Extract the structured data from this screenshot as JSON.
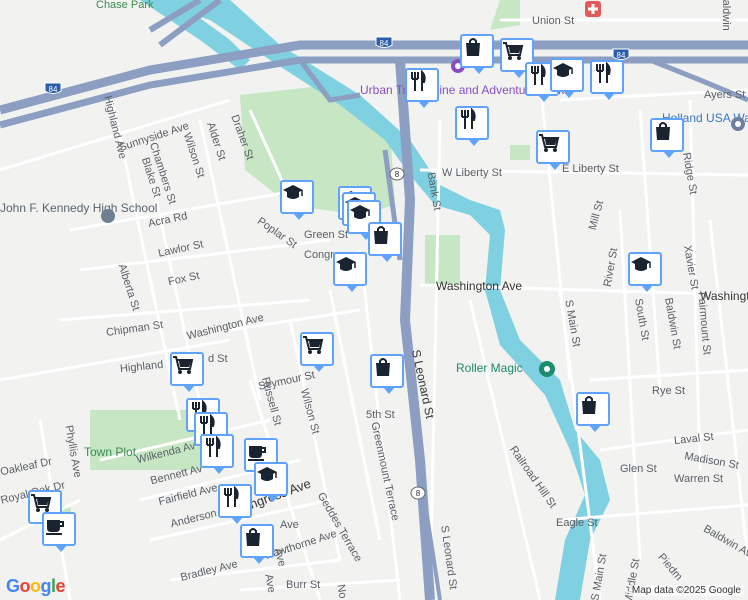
{
  "map": {
    "streets": [
      {
        "name": "Chase Park"
      },
      {
        "name": "Union St"
      },
      {
        "name": "Baldwin"
      },
      {
        "name": "Ayers St"
      },
      {
        "name": "Sunnyside Ave"
      },
      {
        "name": "Draher St"
      },
      {
        "name": "Alder St"
      },
      {
        "name": "Wilson St"
      },
      {
        "name": "Chambers St"
      },
      {
        "name": "Blake St"
      },
      {
        "name": "Highland Ave"
      },
      {
        "name": "W Liberty St"
      },
      {
        "name": "E Liberty St"
      },
      {
        "name": "Bank St"
      },
      {
        "name": "Acra Rd"
      },
      {
        "name": "Poplar St"
      },
      {
        "name": "Green St"
      },
      {
        "name": "Congress"
      },
      {
        "name": "Lawlor St"
      },
      {
        "name": "Fox St"
      },
      {
        "name": "Alberta St"
      },
      {
        "name": "Chipman St"
      },
      {
        "name": "Washington Ave"
      },
      {
        "name": "Washington Ave"
      },
      {
        "name": "Washington Ave"
      },
      {
        "name": "Mill St"
      },
      {
        "name": "River St"
      },
      {
        "name": "Xavier St"
      },
      {
        "name": "South St"
      },
      {
        "name": "Baldwin St"
      },
      {
        "name": "Fairmount St"
      },
      {
        "name": "Ridge St"
      },
      {
        "name": "S Main St"
      },
      {
        "name": "Highland"
      },
      {
        "name": "d St"
      },
      {
        "name": "Seymour St"
      },
      {
        "name": "Russell St"
      },
      {
        "name": "Wilson St"
      },
      {
        "name": "S Leonard St"
      },
      {
        "name": "5th St"
      },
      {
        "name": "Greenmount Terrace"
      },
      {
        "name": "Rye St"
      },
      {
        "name": "Laval St"
      },
      {
        "name": "Madison St"
      },
      {
        "name": "Glen St"
      },
      {
        "name": "Warren St"
      },
      {
        "name": "Railroad Hill St"
      },
      {
        "name": "Wilkenda Av"
      },
      {
        "name": "Bennett Av"
      },
      {
        "name": "Fairfield Ave"
      },
      {
        "name": "Anderson Av"
      },
      {
        "name": "Congress Ave"
      },
      {
        "name": "Geddes Terrace"
      },
      {
        "name": "Hawthorne Ave"
      },
      {
        "name": "Bradley Ave"
      },
      {
        "name": "Burr St"
      },
      {
        "name": "Phyllis Ave"
      },
      {
        "name": "Oakleaf Dr"
      },
      {
        "name": "Royal Oak Dr"
      },
      {
        "name": "Eagle St"
      },
      {
        "name": "S Leonard St"
      },
      {
        "name": "Baldwin Ave"
      },
      {
        "name": "Piedm"
      },
      {
        "name": "Middle St"
      },
      {
        "name": "S Main St"
      },
      {
        "name": "No"
      },
      {
        "name": "Ave"
      },
      {
        "name": "Ave"
      },
      {
        "name": "Ave"
      }
    ],
    "places": [
      {
        "name": "Urban Trampoline and Adventure Park",
        "color": "#8a4fbf"
      },
      {
        "name": "Holland USA Waterbury",
        "color": "#3b78c4"
      },
      {
        "name": "John F. Kennedy High School",
        "color": "#5a6470"
      },
      {
        "name": "Roller Magic",
        "color": "#1e8a6e"
      },
      {
        "name": "Town Plot",
        "color": "#3d8b4f"
      }
    ],
    "highway_shields": [
      "84",
      "84",
      "84",
      "8",
      "8"
    ],
    "colors": {
      "land": "#f2f2f0",
      "water": "#7fd0e0",
      "park": "#c6e6c4",
      "highway": "#8c9fc2",
      "road": "#ffffff",
      "pin_border": "#5fa3ff"
    },
    "attribution": "Map data ©2025 Google",
    "logo": "Google"
  },
  "markers": [
    {
      "icon": "shopping-bag-icon"
    },
    {
      "icon": "cart-icon"
    },
    {
      "icon": "restaurant-icon"
    },
    {
      "icon": "restaurant-icon"
    },
    {
      "icon": "school-icon"
    },
    {
      "icon": "restaurant-icon"
    },
    {
      "icon": "restaurant-icon"
    },
    {
      "icon": "shopping-bag-icon"
    },
    {
      "icon": "cart-icon"
    },
    {
      "icon": "school-icon"
    },
    {
      "icon": "school-icon"
    },
    {
      "icon": "school-icon"
    },
    {
      "icon": "school-icon"
    },
    {
      "icon": "shopping-bag-icon"
    },
    {
      "icon": "school-icon"
    },
    {
      "icon": "school-icon"
    },
    {
      "icon": "cart-icon"
    },
    {
      "icon": "cart-icon"
    },
    {
      "icon": "shopping-bag-icon"
    },
    {
      "icon": "shopping-bag-icon"
    },
    {
      "icon": "restaurant-icon"
    },
    {
      "icon": "restaurant-icon"
    },
    {
      "icon": "restaurant-icon"
    },
    {
      "icon": "coffee-icon"
    },
    {
      "icon": "school-icon"
    },
    {
      "icon": "restaurant-icon"
    },
    {
      "icon": "shopping-bag-icon"
    },
    {
      "icon": "cart-icon"
    },
    {
      "icon": "coffee-icon"
    }
  ]
}
